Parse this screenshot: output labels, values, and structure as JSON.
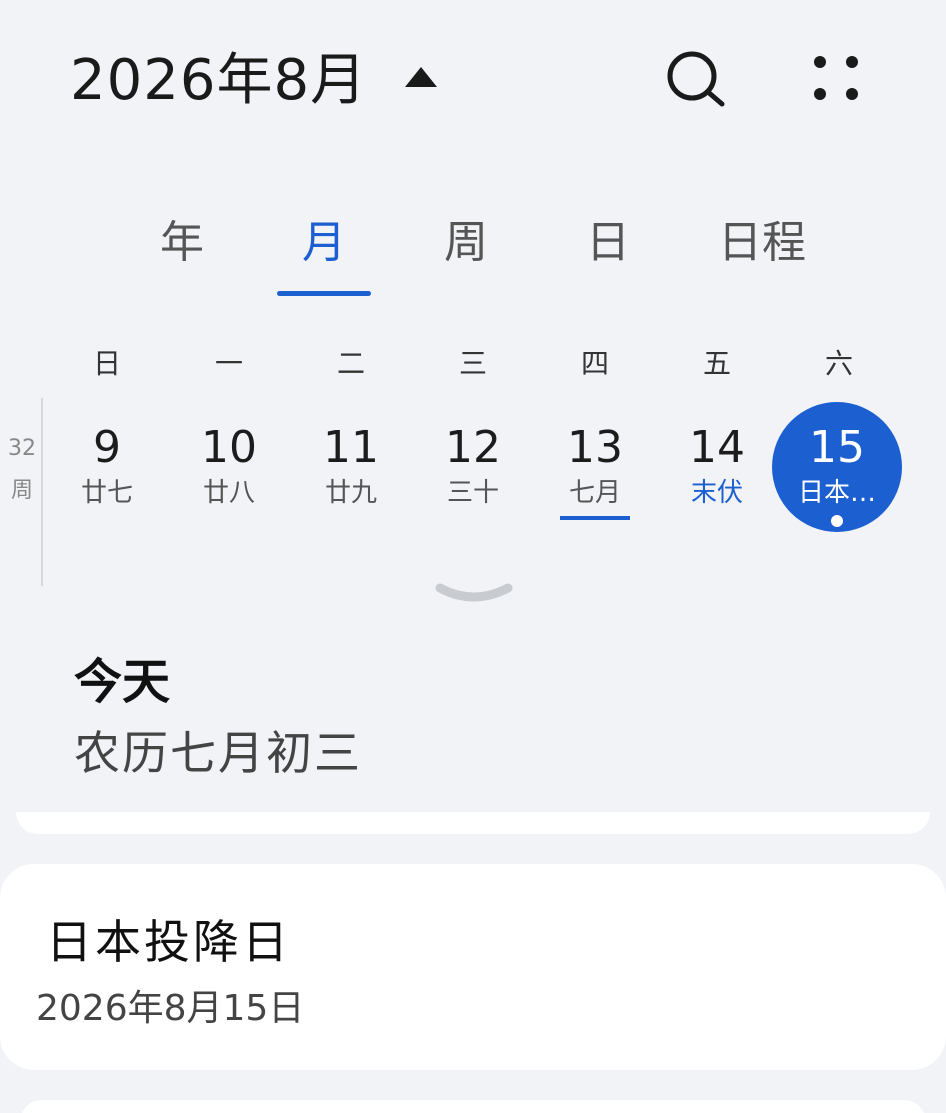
{
  "header": {
    "month_title": "2026年8月",
    "search_icon": "search-icon",
    "more_icon": "more-dots-icon"
  },
  "tabs": [
    {
      "label": "年"
    },
    {
      "label": "月"
    },
    {
      "label": "周"
    },
    {
      "label": "日"
    },
    {
      "label": "日程"
    }
  ],
  "active_tab": "月",
  "weekdays": [
    "日",
    "一",
    "二",
    "三",
    "四",
    "五",
    "六"
  ],
  "week": {
    "number": "32",
    "unit": "周",
    "days": [
      {
        "num": "9",
        "lunar": "廿七"
      },
      {
        "num": "10",
        "lunar": "廿八"
      },
      {
        "num": "11",
        "lunar": "廿九"
      },
      {
        "num": "12",
        "lunar": "三十"
      },
      {
        "num": "13",
        "lunar": "七月"
      },
      {
        "num": "14",
        "lunar": "末伏"
      },
      {
        "num": "15",
        "lunar": "日本…"
      }
    ]
  },
  "today": {
    "label": "今天",
    "lunar": "农历七月初三"
  },
  "event": {
    "title": "日本投降日",
    "date": "2026年8月15日"
  },
  "colors": {
    "accent": "#1b5fd1",
    "background": "#f1f3f6",
    "card": "#ffffff"
  }
}
